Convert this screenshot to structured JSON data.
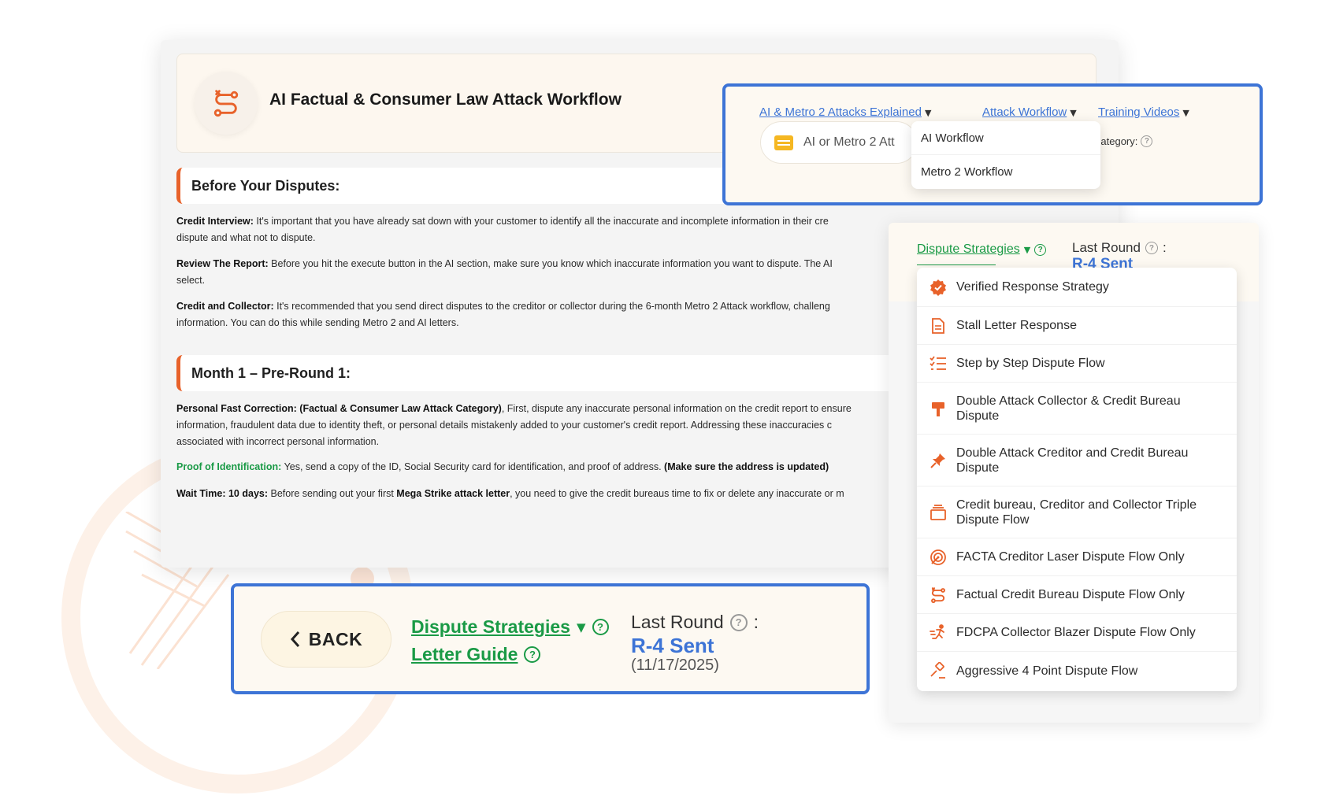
{
  "page": {
    "title": "AI Factual & Consumer Law Attack Workflow"
  },
  "sections": {
    "before": {
      "heading": "Before Your Disputes:",
      "credit_interview_label": "Credit Interview:",
      "credit_interview_text_1": " It's important that you have already sat down with your customer to identify all the inaccurate and incomplete information in their cre",
      "credit_interview_text_2": "dispute and what not to dispute.",
      "review_report_label": "Review The Report:",
      "review_report_text_1": " Before you hit the execute button in the AI section, make sure you know which inaccurate information you want to dispute. The AI",
      "review_report_text_2": "select.",
      "creditor_collector_label": "Credit and Collector:",
      "creditor_collector_text_1": " It's recommended that you send direct disputes to the creditor or collector during the 6-month Metro 2 Attack workflow, challeng",
      "creditor_collector_text_2": "information. You can do this while sending Metro 2 and AI letters."
    },
    "month1": {
      "heading": "Month 1 – Pre-Round 1:",
      "personal_label": "Personal Fast Correction: (Factual & Consumer Law Attack Category)",
      "personal_text_1": ", First, dispute any inaccurate personal information on the credit report to ensure",
      "personal_text_2": "information, fraudulent data due to identity theft, or personal details mistakenly added to your customer's credit report. Addressing these inaccuracies c",
      "personal_text_3": "associated with incorrect personal information.",
      "proof_label": "Proof of Identification:",
      "proof_text": " Yes, send a copy of the ID, Social Security card for identification, and proof of address. ",
      "proof_bold": "(Make sure the address is updated)",
      "wait_label": "Wait Time: 10 days:",
      "wait_text_1": " Before sending out your first ",
      "wait_bold": "Mega Strike attack letter",
      "wait_text_2": ", you need to give the credit bureaus time to fix or delete any inaccurate or m"
    }
  },
  "top_panel": {
    "link_explained": "AI & Metro 2 Attacks Explained",
    "link_workflow": "Attack Workflow",
    "link_training": "Training Videos",
    "select_placeholder": "AI or Metro 2 Att",
    "category_label": "Category:",
    "workflow_menu": [
      "AI Workflow",
      "Metro 2 Workflow"
    ]
  },
  "right_panel": {
    "strategies_link": "Dispute Strategies",
    "last_round_label": "Last Round",
    "last_round_value": "R-4 Sent",
    "strategies": [
      {
        "label": "Verified Response Strategy",
        "icon": "verified-badge-icon"
      },
      {
        "label": "Stall Letter Response",
        "icon": "document-icon"
      },
      {
        "label": "Step by Step Dispute Flow",
        "icon": "checklist-icon"
      },
      {
        "label": "Double Attack Collector & Credit Bureau Dispute",
        "icon": "hammer-icon"
      },
      {
        "label": "Double Attack Creditor and Credit Bureau Dispute",
        "icon": "pushpin-icon"
      },
      {
        "label": "Credit bureau, Creditor and Collector Triple Dispute Flow",
        "icon": "stacked-box-icon"
      },
      {
        "label": "FACTA Creditor Laser Dispute Flow Only",
        "icon": "laser-target-icon"
      },
      {
        "label": "Factual Credit Bureau Dispute Flow Only",
        "icon": "route-icon"
      },
      {
        "label": "FDCPA Collector Blazer Dispute Flow Only",
        "icon": "running-icon"
      },
      {
        "label": "Aggressive 4 Point Dispute Flow",
        "icon": "gavel-icon"
      }
    ]
  },
  "bottom_panel": {
    "back_label": "BACK",
    "strategies_link": "Dispute Strategies",
    "letter_guide_link": "Letter Guide",
    "last_round_label": "Last Round",
    "last_round_value": "R-4 Sent",
    "last_round_date": "(11/17/2025)"
  },
  "colors": {
    "accent_orange": "#e8622a",
    "link_blue": "#3d74d6",
    "link_green": "#1a9a46",
    "highlight_border": "#3d74d6"
  }
}
